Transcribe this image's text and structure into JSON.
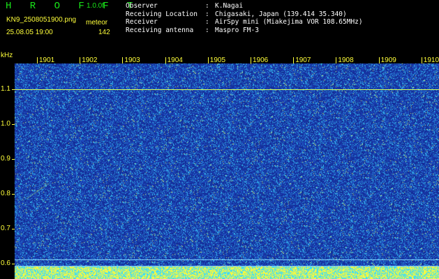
{
  "header": {
    "app_title": "H R O F F T",
    "version": "1.0.0f",
    "filename": "KN9_2508051900.png",
    "datetime": "25.08.05 19:00",
    "mode": "meteor",
    "count": "142"
  },
  "info": [
    {
      "key": "Observer",
      "sep": ":",
      "value": "K.Nagai"
    },
    {
      "key": "Receiving Location",
      "sep": ":",
      "value": "Chigasaki, Japan (139.414 35.340)"
    },
    {
      "key": "Receiver",
      "sep": ":",
      "value": "AirSpy mini (Miakejima VOR 108.65MHz)"
    },
    {
      "key": "Receiving antenna",
      "sep": ":",
      "value": "Maspro FM-3"
    }
  ],
  "spectrogram": {
    "y_unit": "kHz",
    "y_ticks": [
      {
        "label": "1.1",
        "value": 1.1
      },
      {
        "label": "1.0",
        "value": 1.0
      },
      {
        "label": "0.9",
        "value": 0.9
      },
      {
        "label": "0.8",
        "value": 0.8
      },
      {
        "label": "0.7",
        "value": 0.7
      },
      {
        "label": "0.6",
        "value": 0.6
      }
    ],
    "x_ticks": [
      "1901",
      "1902",
      "1903",
      "1904",
      "1905",
      "1906",
      "1907",
      "1908",
      "1909",
      "1910"
    ],
    "colors": {
      "background": "#1f3fb0",
      "noise_light": "#39d6ff",
      "noise_yellow": "#ffff3a",
      "label": "#ffff3a"
    }
  }
}
